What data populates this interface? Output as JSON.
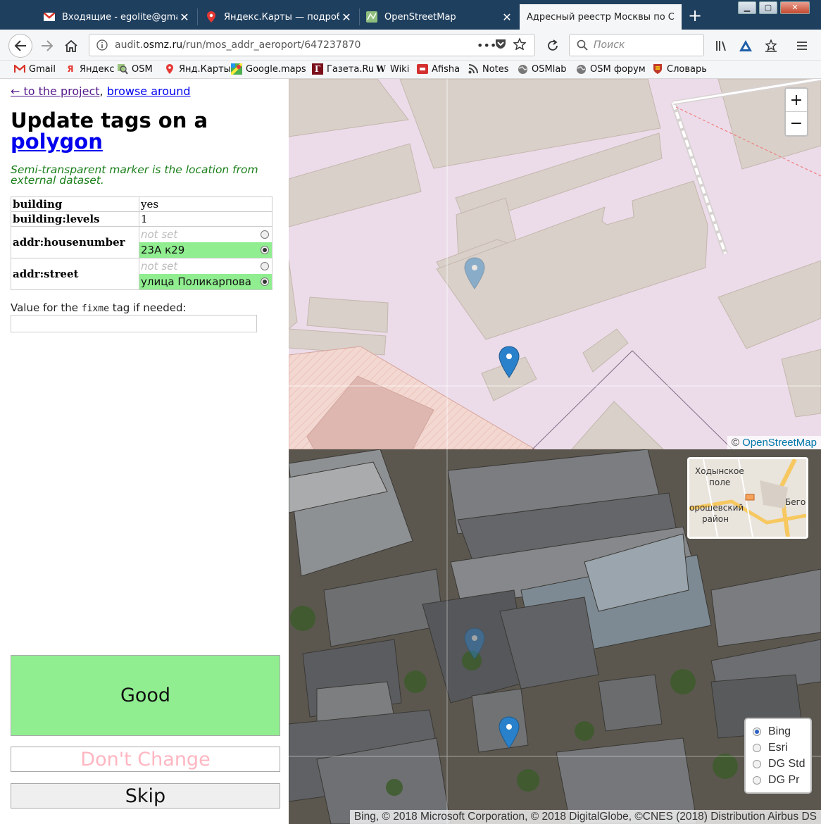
{
  "browser": {
    "tabs": [
      {
        "label": "Входящие - egolite@gmail.c",
        "icon": "gmail-icon"
      },
      {
        "label": "Яндекс.Карты — подробна",
        "icon": "map-pin-icon"
      },
      {
        "label": "OpenStreetMap",
        "icon": "osm-icon"
      },
      {
        "label": "Адресный реестр Москвы по С",
        "icon": "none"
      }
    ],
    "url_prefix": "audit.",
    "url_host": "osmz.ru",
    "url_path": "/run/mos_addr_aeroport/647237870",
    "search_placeholder": "Поиск",
    "bookmarks": [
      "Gmail",
      "Яндекс",
      "OSM",
      "Янд.Карты",
      "Google.maps",
      "Газета.Ru",
      "Wiki",
      "Afisha",
      "Notes",
      "OSMlab",
      "OSM форум",
      "Словарь"
    ]
  },
  "panel": {
    "back_link": "← to the project",
    "sep": ",",
    "browse_link": "browse around",
    "title_prefix": "Update tags on a",
    "title_link": "polygon",
    "hint": "Semi-transparent marker is the location from external dataset.",
    "tags": {
      "building": {
        "key": "building",
        "value": "yes"
      },
      "levels": {
        "key": "building:levels",
        "value": "1"
      },
      "housenumber": {
        "key": "addr:housenumber",
        "notset": "not set",
        "value": "23А к29"
      },
      "street": {
        "key": "addr:street",
        "notset": "not set",
        "value": "улица Поликарпова"
      }
    },
    "fixme_label_pre": "Value for the",
    "fixme_tag": "fixme",
    "fixme_label_post": "tag if needed:",
    "fixme_value": "",
    "good_label": "Good",
    "dontchange_label": "Don't Change",
    "skip_label": "Skip"
  },
  "map_osm": {
    "zoom_in": "+",
    "zoom_out": "−",
    "attribution_symbol": "©",
    "attribution_link": "OpenStreetMap"
  },
  "map_sat": {
    "attribution": "Bing, © 2018 Microsoft Corporation, © 2018 DigitalGlobe, ©CNES (2018) Distribution Airbus DS",
    "layers": [
      "Bing",
      "Esri",
      "DG Std",
      "DG Pr"
    ],
    "selected_layer": "Bing",
    "minimap_labels": [
      "Ходынское",
      "поле",
      "орошевский",
      "район",
      "Бегов"
    ]
  },
  "colors": {
    "good": "#90ee90",
    "dontchange_text": "#ffb6c1",
    "marker": "#2a81cb",
    "osm_bg": "#ecdcea",
    "building": "#d9d0c9"
  }
}
